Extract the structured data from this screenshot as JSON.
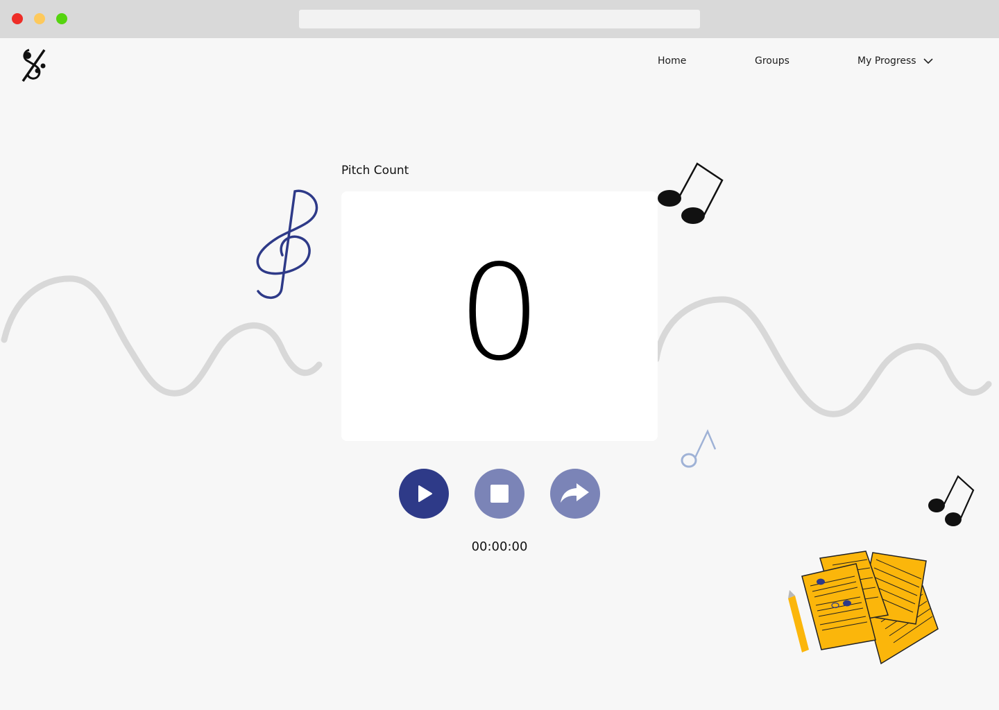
{
  "browser": {
    "address": ""
  },
  "nav": {
    "home": "Home",
    "groups": "Groups",
    "my_progress": "My Progress"
  },
  "counter": {
    "label": "Pitch Count",
    "value": "0"
  },
  "controls": {
    "play_icon": "play-icon",
    "stop_icon": "stop-icon",
    "next_icon": "share-arrow-icon"
  },
  "timer": {
    "value": "00:00:00"
  },
  "colors": {
    "primary": "#2e3a88",
    "secondary": "#7b84b7",
    "accent": "#fbb60b",
    "background": "#f7f7f7"
  }
}
